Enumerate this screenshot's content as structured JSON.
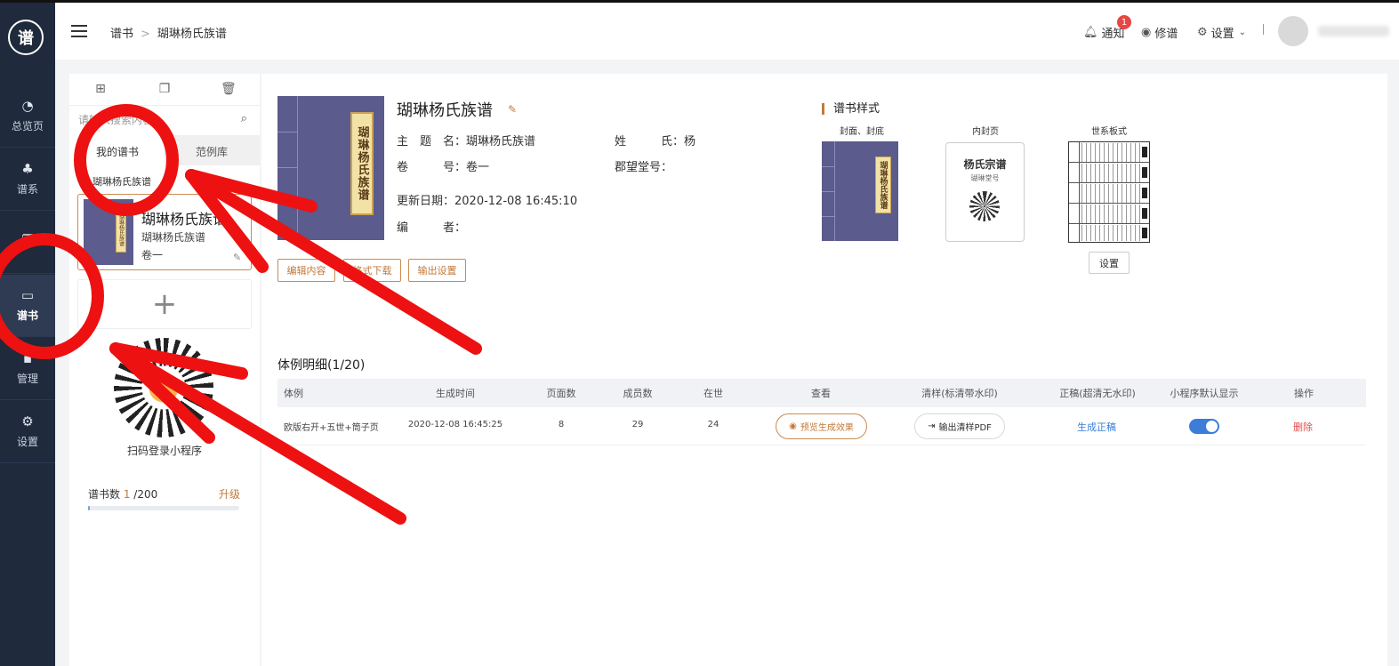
{
  "sidebar": {
    "logo": "谱",
    "items": [
      {
        "label": "总览页",
        "icon": "pie-chart-icon",
        "glyph": "◔"
      },
      {
        "label": "谱系",
        "icon": "tree-icon",
        "glyph": "♣"
      },
      {
        "label": "",
        "icon": "copy-icon",
        "glyph": "❐"
      },
      {
        "label": "谱书",
        "icon": "book-icon",
        "glyph": "▭"
      },
      {
        "label": "管理",
        "icon": "apps-icon",
        "glyph": "▪"
      },
      {
        "label": "设置",
        "icon": "gear-icon",
        "glyph": "⚙"
      }
    ]
  },
  "header": {
    "breadcrumb": [
      "谱书",
      "瑚琳杨氏族谱"
    ],
    "notify_label": "通知",
    "notify_count": "1",
    "revise_label": "修谱",
    "settings_label": "设置"
  },
  "left": {
    "search_placeholder": "请输入搜索内容",
    "tabs": [
      "我的谱书",
      "范例库"
    ],
    "selected_name": "瑚琳杨氏族谱",
    "card": {
      "title": "瑚琳杨氏族谱",
      "subtitle": "瑚琳杨氏族谱",
      "volume": "卷一",
      "thumb_text": "瑚琳杨氏族谱"
    },
    "add_symbol": "+",
    "qr_label": "扫码登录小程序",
    "count_label": "谱书数",
    "count_used": "1",
    "count_total": " /200",
    "count_fraction": 0.005,
    "upgrade_label": "升级"
  },
  "book": {
    "title": "瑚琳杨氏族谱",
    "cover_text": "瑚琳杨氏族谱",
    "theme_label": "主　题　名：",
    "theme_value": "瑚琳杨氏族谱",
    "surname_label": "姓　　　氏：",
    "surname_value": "杨",
    "volume_label": "卷　　　号：",
    "volume_value": "卷一",
    "hall_label": "郡望堂号：",
    "hall_value": "",
    "updated_label": "更新日期：",
    "updated_value": "2020-12-08 16:45:10",
    "editor_label": "编　　　者：",
    "editor_value": "",
    "buttons": [
      "编辑内容",
      "格式下载",
      "输出设置"
    ]
  },
  "style": {
    "title": "谱书样式",
    "captions": [
      "封面、封底",
      "内封页",
      "世系板式"
    ],
    "cover_text": "瑚琳杨氏族谱",
    "inner_title": "杨氏宗谱",
    "inner_sub": "瑚琳堂号",
    "inner_foot": "",
    "settings_button": "设置"
  },
  "detail": {
    "title": "体例明细(1/20)",
    "headers": [
      "体例",
      "生成时间",
      "页面数",
      "成员数",
      "在世",
      "查看",
      "清样(标清带水印)",
      "正稿(超清无水印)",
      "小程序默认显示",
      "操作"
    ],
    "rows": [
      {
        "style": "欧版右开+五世+筒子页",
        "time": "2020-12-08 16:45:25",
        "pages": "8",
        "members": "29",
        "alive": "24",
        "preview": "预览生成效果",
        "pdf": "输出清样PDF",
        "generate": "生成正稿",
        "toggle_on": true,
        "delete": "删除"
      }
    ]
  },
  "colors": {
    "sidebar": "#1f2a3c",
    "accent": "#c27a3b",
    "link": "#3b7dd8",
    "danger": "#e04c4c",
    "annotation": "#ee1111"
  }
}
